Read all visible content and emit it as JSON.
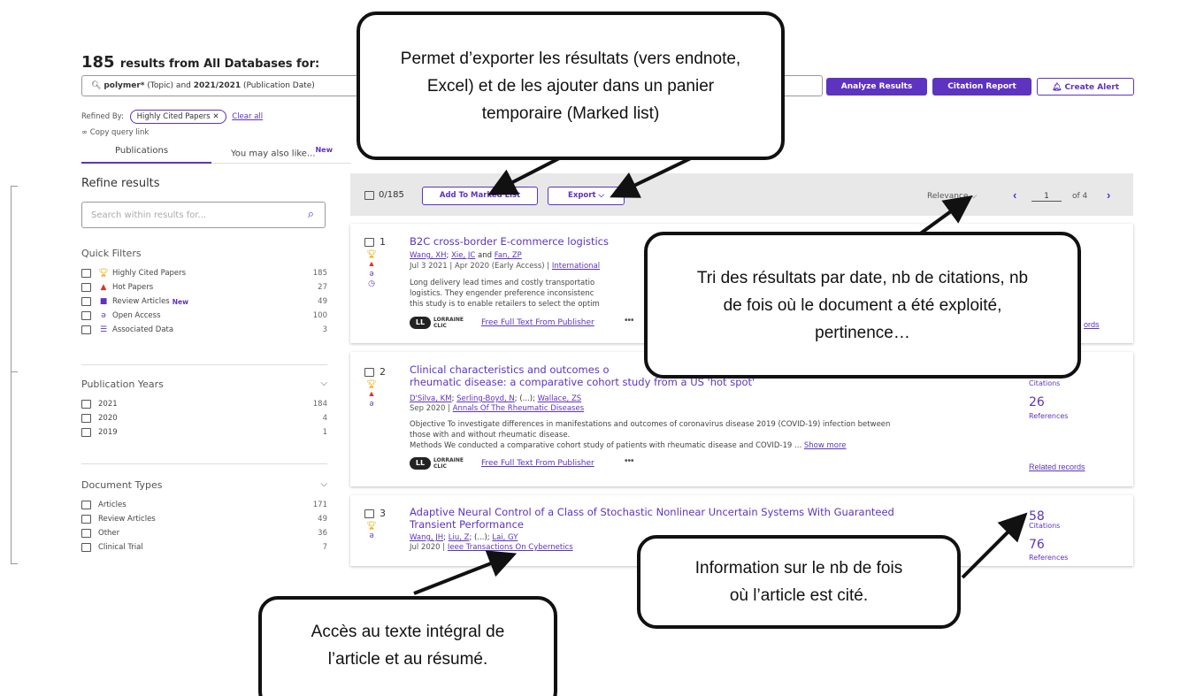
{
  "header": {
    "count": "185",
    "title_rest": "results from All Databases for:",
    "query_q1": "polymer*",
    "query_t1": "(Topic) and",
    "query_q2": "2021/2021",
    "query_t2": "(Publication Date)",
    "analyze_label": "Analyze Results",
    "citation_label": "Citation Report",
    "alert_label": "Create Alert",
    "refined_by": "Refined By:",
    "refined_chip": "Highly Cited Papers",
    "clear_all": "Clear all",
    "copy_link": "Copy query link",
    "tab_publications": "Publications",
    "tab_also_like": "You may also like...",
    "tab_new": "New"
  },
  "sidebar": {
    "refine_title": "Refine results",
    "search_placeholder": "Search within results for...",
    "quick_filters_title": "Quick Filters",
    "quick_filters": [
      {
        "label": "Highly Cited Papers",
        "count": "185",
        "icon": "trophy-icon"
      },
      {
        "label": "Hot Papers",
        "count": "27",
        "icon": "fire-icon"
      },
      {
        "label": "Review Articles",
        "count": "49",
        "icon": "review-icon",
        "badge": "New"
      },
      {
        "label": "Open Access",
        "count": "100",
        "icon": "open-access-icon"
      },
      {
        "label": "Associated Data",
        "count": "3",
        "icon": "database-icon"
      }
    ],
    "pub_years_title": "Publication Years",
    "pub_years": [
      {
        "label": "2021",
        "count": "184"
      },
      {
        "label": "2020",
        "count": "4"
      },
      {
        "label": "2019",
        "count": "1"
      }
    ],
    "doc_types_title": "Document Types",
    "doc_types": [
      {
        "label": "Articles",
        "count": "171"
      },
      {
        "label": "Review Articles",
        "count": "49"
      },
      {
        "label": "Other",
        "count": "36"
      },
      {
        "label": "Clinical Trial",
        "count": "7"
      }
    ]
  },
  "toolbar": {
    "selected": "0/185",
    "add_marked": "Add To Marked List",
    "export": "Export",
    "sort": "Relevance",
    "page": "1",
    "of_pages": "of 4"
  },
  "results": [
    {
      "num": "1",
      "title": "B2C cross-border E-commerce logistics",
      "authors_a": "Wang, XH",
      "authors_b": "Xie, JC",
      "authors_and": "and",
      "authors_c": "Fan, ZP",
      "date": "Jul 3 2021 | Apr 2020 (Early Access) |",
      "journal": "International",
      "abstract_1": "Long delivery lead times and costly transportatio",
      "abstract_2": "logistics. They engender preference inconsistenc",
      "abstract_3": "this study is to enable retailers to select the optim",
      "fft": "Free Full Text From Publisher",
      "related": "ords"
    },
    {
      "num": "2",
      "title_1": "Clinical characteristics and outcomes o",
      "title_2": "rheumatic disease: a comparative cohort study from a US 'hot spot'",
      "authors_a": "D'Silva, KM",
      "authors_b": "Serling-Boyd, N",
      "authors_mid": "(...);",
      "authors_c": "Wallace, ZS",
      "date": "Sep 2020 |",
      "journal": "Annals Of The Rheumatic Diseases",
      "abstract_1": "Objective To investigate differences in manifestations and outcomes of coronavirus disease 2019 (COVID-19) infection between",
      "abstract_2": "those with and without rheumatic disease.",
      "abstract_3": "Methods We conducted a comparative cohort study of patients with rheumatic disease and COVID-19 ...",
      "show_more": "Show more",
      "citations_label": "Citations",
      "references": "26",
      "references_label": "References",
      "fft": "Free Full Text From Publisher",
      "related": "Related records"
    },
    {
      "num": "3",
      "title_1": "Adaptive Neural Control of a Class of Stochastic Nonlinear Uncertain Systems With Guaranteed",
      "title_2": "Transient Performance",
      "authors_a": "Wang, JH",
      "authors_b": "Liu, Z",
      "authors_mid": "(...);",
      "authors_c": "Lai, GY",
      "date": "Jul 2020 |",
      "journal": "Ieee Transactions On Cybernetics",
      "citations": "58",
      "citations_label": "Citations",
      "references": "76",
      "references_label": "References"
    }
  ],
  "lorraine": {
    "logo": "LL",
    "line1": "LORRAINE",
    "line2": "CLIC"
  },
  "callouts": {
    "export": "Permet d’exporter les résultats (vers endnote, Excel) et de les ajouter dans un panier temporaire (Marked list)",
    "sort": "Tri des résultats par date, nb de citations, nb de fois où le document a été exploité, pertinence…",
    "citations": "Information sur le nb de fois où l’article est cité.",
    "fulltext": "Accès au texte intégral de l’article et au résumé."
  },
  "colors": {
    "accent": "#5e33bf",
    "trophy": "#e8a800",
    "hot": "#d9342b"
  }
}
